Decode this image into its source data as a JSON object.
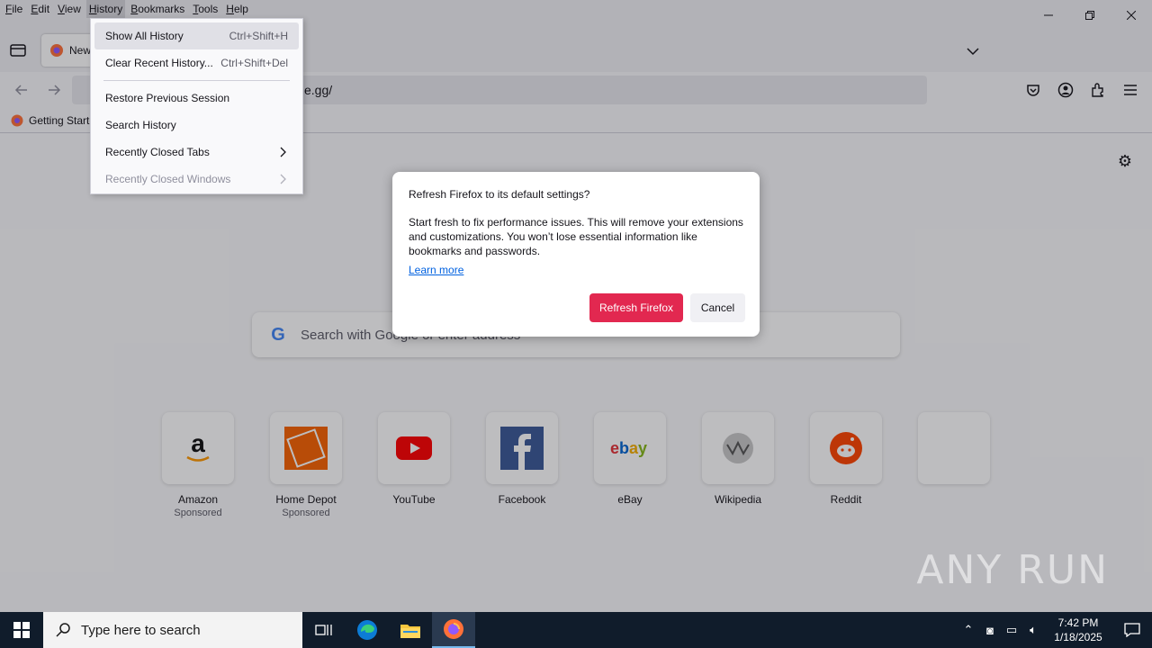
{
  "menubar": {
    "items": [
      {
        "label_u": "F",
        "label_rest": "ile"
      },
      {
        "label_u": "E",
        "label_rest": "dit"
      },
      {
        "label_u": "V",
        "label_rest": "iew"
      },
      {
        "label_u": "H",
        "label_rest": "istory"
      },
      {
        "label_u": "B",
        "label_rest": "ookmarks"
      },
      {
        "label_u": "T",
        "label_rest": "ools"
      },
      {
        "label_u": "H",
        "label_rest": "elp"
      }
    ]
  },
  "tab": {
    "title": "New Tab"
  },
  "urlbar": {
    "value": "e.gg/"
  },
  "bookmarks": {
    "item": "Getting Started"
  },
  "history_menu": {
    "items": [
      {
        "label": "Show All History",
        "shortcut": "Ctrl+Shift+H"
      },
      {
        "label": "Clear Recent History...",
        "shortcut": "Ctrl+Shift+Del"
      },
      {
        "label": "Restore Previous Session"
      },
      {
        "label": "Search History"
      },
      {
        "label": "Recently Closed Tabs"
      },
      {
        "label": "Recently Closed Windows"
      }
    ]
  },
  "search": {
    "placeholder": "Search with Google or enter address"
  },
  "top_sites": [
    {
      "name": "Amazon",
      "sponsored": "Sponsored"
    },
    {
      "name": "Home Depot",
      "sponsored": "Sponsored"
    },
    {
      "name": "YouTube"
    },
    {
      "name": "Facebook"
    },
    {
      "name": "eBay"
    },
    {
      "name": "Wikipedia"
    },
    {
      "name": "Reddit"
    }
  ],
  "dialog": {
    "title": "Refresh Firefox to its default settings?",
    "body": "Start fresh to fix performance issues. This will remove your extensions and customizations. You won’t lose essential information like bookmarks and passwords.",
    "learn_more": "Learn more",
    "refresh_button": "Refresh Firefox",
    "cancel_button": "Cancel"
  },
  "watermark": "ANY RUN",
  "taskbar": {
    "search_placeholder": "Type here to search",
    "time": "7:42 PM",
    "date": "1/18/2025"
  },
  "colors": {
    "accent": "#e22850",
    "link": "#0061e0",
    "taskbar": "#101c2b"
  }
}
